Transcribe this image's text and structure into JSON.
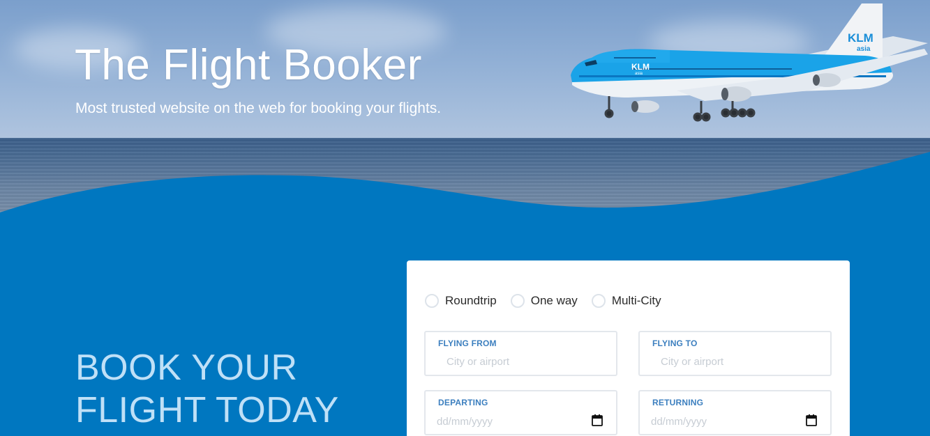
{
  "hero": {
    "title": "The Flight Booker",
    "subtitle": "Most trusted website on the web for booking your flights.",
    "image_alt": "KLM asia airplane flying over the sea"
  },
  "booking": {
    "heading_line1": "BOOK YOUR",
    "heading_line2": "FLIGHT TODAY",
    "trip_types": [
      {
        "label": "Roundtrip",
        "selected": false
      },
      {
        "label": "One way",
        "selected": false
      },
      {
        "label": "Multi-City",
        "selected": false
      }
    ],
    "flying_from": {
      "label": "FLYING FROM",
      "placeholder": "City or airport",
      "value": ""
    },
    "flying_to": {
      "label": "FLYING TO",
      "placeholder": "City or airport",
      "value": ""
    },
    "departing": {
      "label": "DEPARTING",
      "placeholder": "dd/mm/yyyy",
      "icon": "calendar-icon"
    },
    "returning": {
      "label": "RETURNING",
      "placeholder": "dd/mm/yyyy",
      "icon": "calendar-icon"
    }
  },
  "colors": {
    "brand_blue": "#0077c0",
    "heading_light_blue": "#bfe0f7",
    "field_label_blue": "#3c7fbf"
  }
}
